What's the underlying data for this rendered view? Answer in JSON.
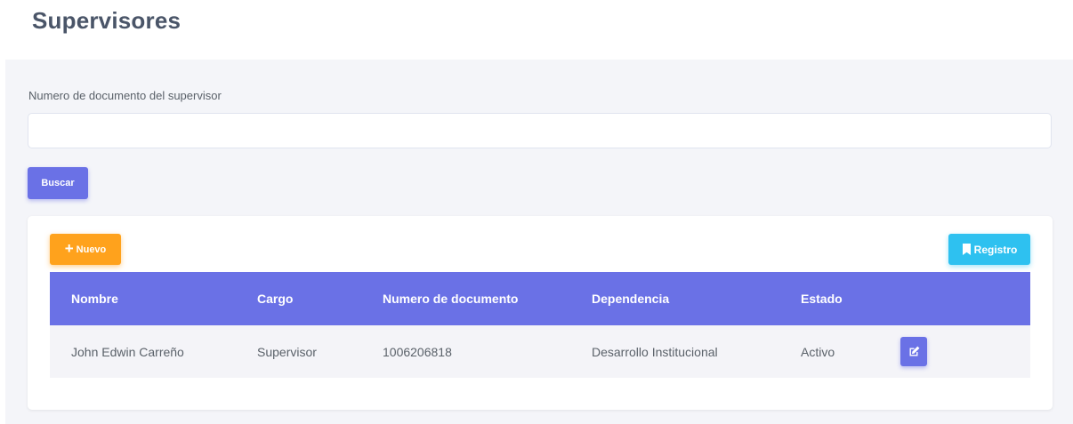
{
  "page": {
    "title": "Supervisores"
  },
  "search": {
    "label": "Numero de documento del supervisor",
    "value": "",
    "placeholder": "",
    "button_label": "Buscar"
  },
  "toolbar": {
    "new_label": "Nuevo",
    "registro_label": "Registro"
  },
  "table": {
    "headers": [
      "Nombre",
      "Cargo",
      "Numero de documento",
      "Dependencia",
      "Estado"
    ],
    "rows": [
      {
        "nombre": "John Edwin Carreño",
        "cargo": "Supervisor",
        "documento": "1006206818",
        "dependencia": "Desarrollo Institucional",
        "estado": "Activo"
      }
    ]
  },
  "icons": {
    "new": "plus-icon",
    "registro": "bookmark-icon",
    "edit": "edit-icon"
  },
  "colors": {
    "primary": "#6a71e6",
    "warning": "#ffa21c",
    "info": "#2ec1f0",
    "title": "#4a5568",
    "background": "#f4f5f9"
  }
}
